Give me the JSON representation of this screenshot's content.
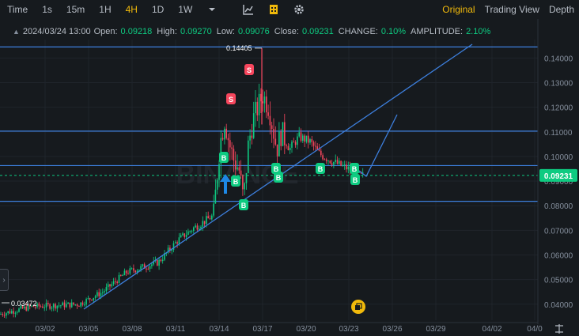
{
  "toolbar": {
    "intervals": [
      "Time",
      "1s",
      "15m",
      "1H",
      "4H",
      "1D",
      "1W"
    ],
    "active_interval": "4H",
    "views": [
      "Original",
      "Trading View",
      "Depth"
    ],
    "active_view": "Original"
  },
  "info": {
    "date": "2024/03/24 13:00",
    "open_label": "Open:",
    "open": "0.09218",
    "high_label": "High:",
    "high": "0.09270",
    "low_label": "Low:",
    "low": "0.09076",
    "close_label": "Close:",
    "close": "0.09231",
    "change_label": "CHANGE:",
    "change": "0.10%",
    "amplitude_label": "AMPLITUDE:",
    "amplitude": "2.10%"
  },
  "chart_data": {
    "type": "candlestick",
    "title": "",
    "x_ticks": [
      "03/02",
      "03/05",
      "03/08",
      "03/11",
      "03/14",
      "03/17",
      "03/20",
      "03/23",
      "03/26",
      "03/29",
      "04/02",
      "04/0"
    ],
    "y_ticks": [
      "0.14000",
      "0.13000",
      "0.12000",
      "0.11000",
      "0.10000",
      "0.09000",
      "0.08000",
      "0.07000",
      "0.06000",
      "0.05000",
      "0.04000"
    ],
    "ylim": [
      0.0335,
      0.1475
    ],
    "current_price": "0.09231",
    "high_marker": "0.14405",
    "low_marker": "0.03472",
    "horizontal_lines": [
      0.1445,
      0.1103,
      0.0963,
      0.0818
    ],
    "colors": {
      "up": "#0ecb81",
      "down": "#f6465d",
      "line": "#3d7fdd",
      "accent": "#f0b90b"
    },
    "signal_labels": {
      "buy": "B",
      "sell": "S"
    },
    "watermark": "BINANCE"
  }
}
